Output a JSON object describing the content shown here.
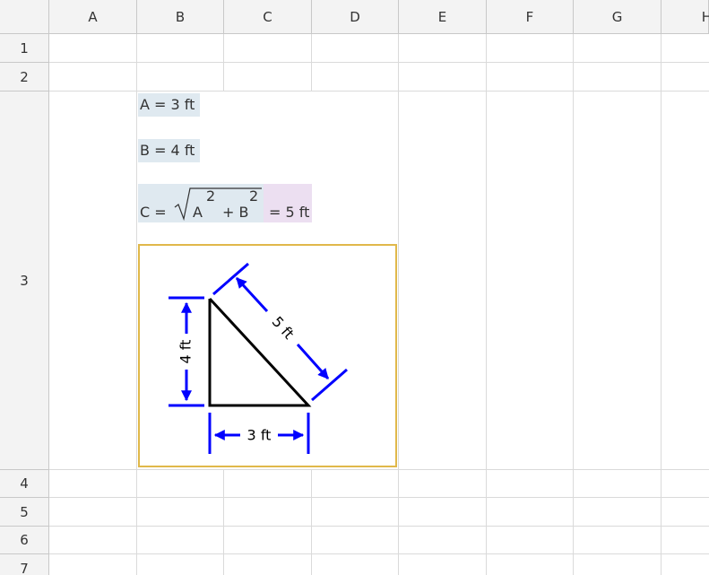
{
  "sheet": {
    "columns": [
      "A",
      "B",
      "C",
      "D",
      "E",
      "F",
      "G",
      "H"
    ],
    "rows": [
      "1",
      "2",
      "3",
      "4",
      "5",
      "6",
      "7"
    ]
  },
  "formulas": {
    "a_line": "A = 3 ft",
    "b_line": "B = 4 ft",
    "c_prefix": "C =",
    "c_radicand_a": "A",
    "c_exp_a": "2",
    "c_plus": "+ B",
    "c_exp_b": "2",
    "c_result": "= 5 ft"
  },
  "diagram": {
    "side_bottom": "3 ft",
    "side_left": "4 ft",
    "hypotenuse": "5 ft"
  },
  "colors": {
    "accent_blue": "#0000ff",
    "frame": "#e0b84a",
    "highlight_blue": "#dfe9f0",
    "highlight_pink": "#ecdff1"
  }
}
